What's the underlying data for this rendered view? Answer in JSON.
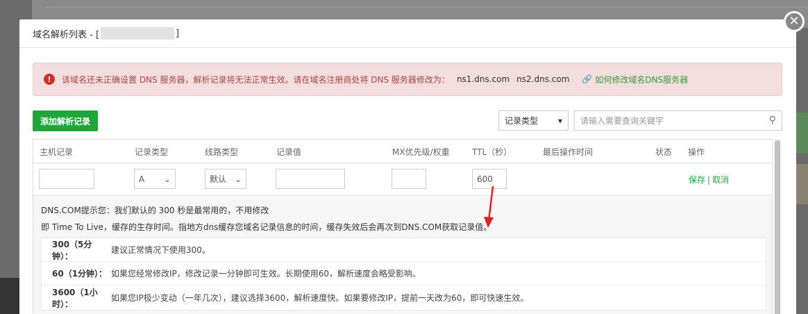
{
  "modal": {
    "title_prefix": "域名解析列表 - [",
    "title_suffix": "]"
  },
  "alert": {
    "message": "该域名还未正确设置 DNS 服务器，解析记录将无法正常生效。请在域名注册商处将 DNS 服务器修改为：",
    "ns1": "ns1.dns.com",
    "ns2": "ns2.dns.com",
    "link_text": "如何修改域名DNS服务器"
  },
  "toolbar": {
    "add_label": "添加解析记录",
    "type_select_value": "记录类型",
    "search_placeholder": "请输入需要查询关键字"
  },
  "table": {
    "columns": [
      "主机记录",
      "记录类型",
      "线路类型",
      "记录值",
      "MX优先级/权重",
      "TTL（秒）",
      "最后操作时间",
      "状态",
      "操作"
    ],
    "edit_row": {
      "host": "",
      "type": "A",
      "line": "默认",
      "value": "",
      "mx": "",
      "ttl": "600",
      "save": "保存",
      "separator": "|",
      "cancel": "取消"
    }
  },
  "tips": {
    "line1": "DNS.COM提示您：我们默认的 300 秒是最常用的，不用修改",
    "line2": "即 Time To Live，缓存的生存时间。指地方dns缓存您域名记录信息的时间，缓存失效后会再次到DNS.COM获取记录值。",
    "items": [
      {
        "key": "300（5分钟）：",
        "desc": "建议正常情况下使用300。"
      },
      {
        "key": "60（1分钟）：",
        "desc": "如果您经常修改IP，修改记录一分钟即可生效。长期使用60，解析速度会略受影响。"
      },
      {
        "key": "3600（1小时）：",
        "desc": "如果您IP极少变动（一年几次），建议选择3600，解析速度快。如果要修改IP，提前一天改为60，即可快速生效。"
      }
    ]
  },
  "colors": {
    "accent_green": "#20a53a",
    "alert_bg": "#f2dede",
    "alert_text": "#a94442",
    "arrow_red": "#e02020"
  },
  "icons": {
    "close": "close-icon",
    "warning": "warning-icon",
    "link": "link-icon",
    "search": "search-icon",
    "chevron": "chevron-down-icon"
  }
}
